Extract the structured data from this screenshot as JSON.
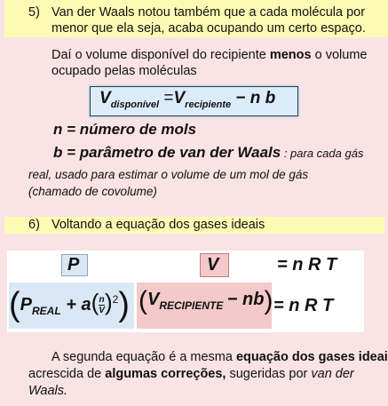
{
  "section5": {
    "number": "5)",
    "line1": "Van der Waals notou também que a cada molécula por",
    "line2": "menor  que ela seja, acaba ocupando um certo espaço."
  },
  "para1": {
    "pre": "Daí o volume disponível do recipiente ",
    "bold": "menos",
    "post": " o volume",
    "line2": "ocupado pelas moléculas"
  },
  "formula1": {
    "v": "V",
    "sub1": "disponível",
    "eq": "=",
    "v2": "V",
    "sub2": "recipiente",
    "rest": "−  n b"
  },
  "def_n": "n = número de mols",
  "def_b": {
    "main": "b = parâmetro de van der Waals",
    "note": " : para cada gás",
    "line2": "real, usado para estimar o volume de um mol de gás",
    "line3": "(chamado de covolume)"
  },
  "section6": {
    "number": "6)",
    "text": "Voltando a equação dos gases ideais"
  },
  "ideal": {
    "p": "P",
    "v": "V",
    "rhs": "=  n  R  T"
  },
  "vdw": {
    "p": "P",
    "p_sub": "REAL",
    "plus_a": "+ a",
    "n": "n",
    "v": "V",
    "exp": "2",
    "v2": "V",
    "v_sub": "RECIPIENTE",
    "minus_nb": "− nb",
    "rhs": "=  n  R  T"
  },
  "para2": {
    "pre": "A segunda equação é a mesma ",
    "bold1": "equação dos gases ideais",
    "line2_pre": "acrescida de ",
    "bold2": "algumas correções,",
    "line2_post": " sugeridas por ",
    "italic": "van der",
    "line3": "Waals."
  }
}
